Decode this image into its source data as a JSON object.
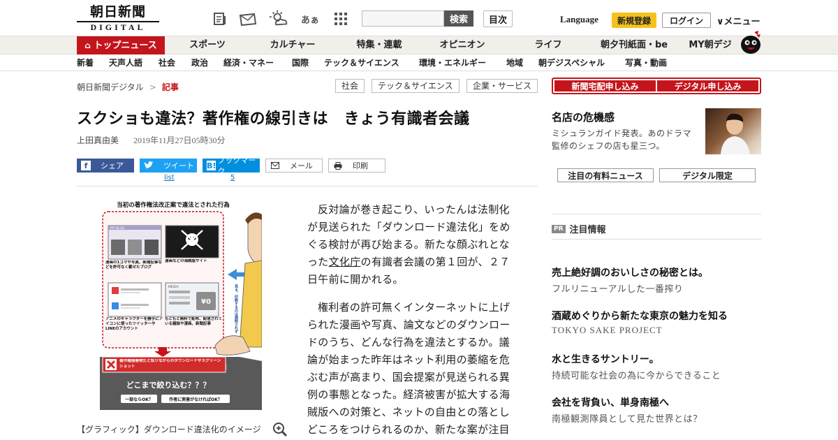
{
  "header": {
    "logo_jp": "朝日新聞",
    "logo_en": "DIGITAL",
    "toolbar_icons": [
      "newspaper-icon",
      "mail-icon",
      "weather-icon",
      "font-size-icon",
      "grid-icon"
    ],
    "font_size_label": "あぁ",
    "search": {
      "placeholder": "",
      "button": "検索"
    },
    "toc_button": "目次",
    "language_label": "Language",
    "register_button": "新規登録",
    "login_button": "ログイン",
    "menu_button": "∨メニュー"
  },
  "nav_primary": [
    "トップニュース",
    "スポーツ",
    "カルチャー",
    "特集・連載",
    "オピニオン",
    "ライフ",
    "朝夕刊紙面・be",
    "MY朝デジ"
  ],
  "nav_secondary": [
    "新着",
    "天声人語",
    "社会",
    "政治",
    "経済・マネー",
    "国際",
    "テック＆サイエンス",
    "環境・エネルギー",
    "地域",
    "朝デジスペシャル",
    "写真・動画"
  ],
  "breadcrumb": {
    "home": "朝日新聞デジタル",
    "separator": ">",
    "current": "記事"
  },
  "tags": [
    "社会",
    "テック＆サイエンス",
    "企業・サービス"
  ],
  "article": {
    "title": "スクショも違法？著作権の線引きは　きょう有識者会議",
    "author": "上田真由美",
    "date": "2019年11月27日05時30分",
    "share": {
      "facebook": "シェア",
      "twitter": "ツイート",
      "twitter_count": "list",
      "hatena": "ブックマーク",
      "hatena_count": "5",
      "mail": "メール",
      "print": "印刷"
    },
    "graphic": {
      "title": "当初の著作権法改正案で違法とされた行為",
      "blog_label": "MY BLOG",
      "box1": "漫画の1コマや写真、新聞記事などを許可なく載せたブログ",
      "box2": "漫画などの海賊版サイト",
      "box3": "アニメのキャラクターを勝手にアイコンに使ったツイッターやLINEのアカウント",
      "box4": "もともと無料で配布、配信されている雑誌や漫画、新聞記事",
      "media_label": "MEDIA",
      "yen_label": "¥0",
      "side_note": "見る、印刷するのは規制されず",
      "red_banner": "著作権侵害物だと知りながらのダウンロードやスクリーンショット",
      "question": "どこまで絞り込む？？？",
      "opt1": "一部ならOK？",
      "opt2": "作者に実害がなければOK？"
    },
    "caption": "【グラフィック】ダウンロード違法化のイメージ",
    "paragraph1_a": "反対論が巻き起こり、いったんは法制化が見送られた「ダウンロード違法化」をめぐる検討が再び始まる。新たな顔ぶれとなった",
    "paragraph1_link": "文化庁",
    "paragraph1_b": "の有識者会議の第１回が、２７日午前に開かれる。",
    "paragraph2": "権利者の許可無くインターネットに上げられた漫画や写真、論文などのダウンロードのうち、どんな行為を違法とするか。議論が始まった昨年はネット利用の萎縮を危ぶむ声が高まり、国会提案が見送られる異例の事態となった。経済被害が拡大する海賊版への対策と、ネットの自由との落としどころをつけられるのか、新たな案が注目"
  },
  "sidebar": {
    "buttons": [
      "新聞宅配申し込み",
      "デジタル申し込み"
    ],
    "feature": {
      "title": "名店の危機感",
      "desc": "ミシュランガイド発表。あのドラマ監修のシェフの店も星三つ。"
    },
    "tabs": [
      "注目の有料ニュース",
      "デジタル限定"
    ],
    "pr_label": "PR",
    "pr_heading": "注目情報",
    "ads": [
      {
        "title": "売上絶好調のおいしさの秘密とは。",
        "sub": "フルリニューアルした一番搾り"
      },
      {
        "title": "酒蔵めぐりから新たな東京の魅力を知る",
        "sub": "TOKYO SAKE PROJECT"
      },
      {
        "title": "水と生きるサントリー。",
        "sub": "持続可能な社会の為に今からできること"
      },
      {
        "title": "会社を背負い、単身南極へ",
        "sub": "南極観測隊員として見た世界とは？"
      }
    ]
  },
  "colors": {
    "brand_red": "#c4151c",
    "nav_bg": "#f1efe9",
    "accent_yellow": "#f5c21b",
    "facebook": "#3b5998",
    "twitter": "#1da1f2",
    "hatena": "#008fde"
  }
}
